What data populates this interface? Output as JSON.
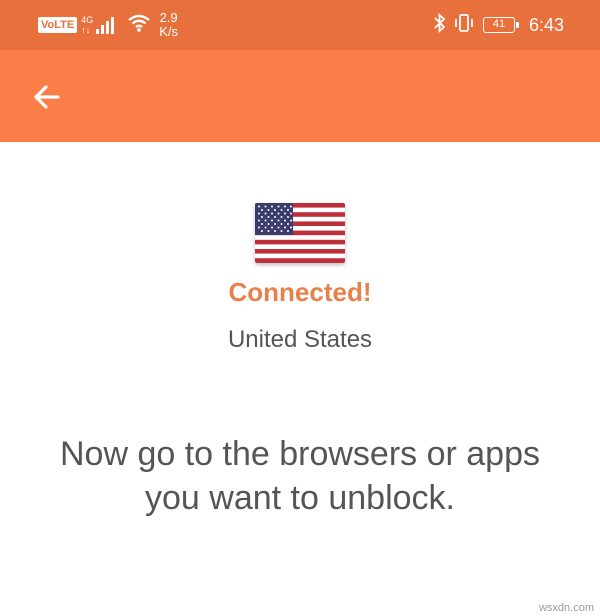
{
  "status_bar": {
    "volte": "VoLTE",
    "network_type": "4G",
    "network_sub": "↑↓",
    "speed_value": "2.9",
    "speed_unit": "K/s",
    "battery_level": "41",
    "time": "6:43",
    "icons": [
      "signal-icon",
      "wifi-icon",
      "bluetooth-icon",
      "vibrate-icon"
    ]
  },
  "app_bar": {
    "back_icon": "arrow-left-icon"
  },
  "connection": {
    "flag_icon": "us-flag-icon",
    "status": "Connected!",
    "country": "United States",
    "message": "Now go to the browsers or apps you want to unblock."
  },
  "watermark": "wsxdn.com",
  "colors": {
    "status_bar_bg": "#e8703c",
    "app_bar_bg": "#fb7e48",
    "status_text": "#e8804c",
    "body_text": "#555555"
  }
}
